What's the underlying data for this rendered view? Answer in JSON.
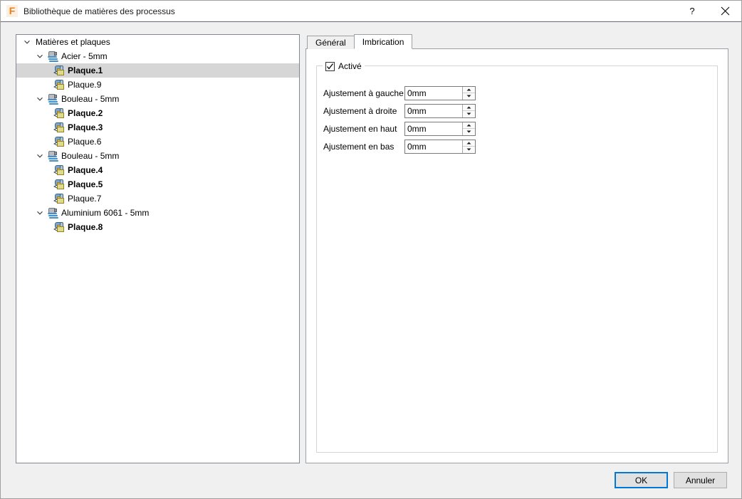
{
  "window": {
    "title": "Bibliothèque de matières des processus",
    "app_icon": "f-logo-icon",
    "help_label": "?",
    "close_label": "✕"
  },
  "tree": {
    "root": {
      "label": "Matières et plaques",
      "expanded": true
    },
    "groups": [
      {
        "label": "Acier - 5mm",
        "expanded": true,
        "icon": "material-stack-icon",
        "plates": [
          {
            "label": "Plaque.1",
            "bold": true,
            "selected": true,
            "icon": "plate-icon"
          },
          {
            "label": "Plaque.9",
            "bold": false,
            "selected": false,
            "icon": "plate-icon"
          }
        ]
      },
      {
        "label": "Bouleau - 5mm",
        "expanded": true,
        "icon": "material-stack-icon",
        "plates": [
          {
            "label": "Plaque.2",
            "bold": true,
            "selected": false,
            "icon": "plate-icon"
          },
          {
            "label": "Plaque.3",
            "bold": true,
            "selected": false,
            "icon": "plate-icon"
          },
          {
            "label": "Plaque.6",
            "bold": false,
            "selected": false,
            "icon": "plate-icon"
          }
        ]
      },
      {
        "label": "Bouleau - 5mm",
        "expanded": true,
        "icon": "material-stack-icon",
        "plates": [
          {
            "label": "Plaque.4",
            "bold": true,
            "selected": false,
            "icon": "plate-icon"
          },
          {
            "label": "Plaque.5",
            "bold": true,
            "selected": false,
            "icon": "plate-icon"
          },
          {
            "label": "Plaque.7",
            "bold": false,
            "selected": false,
            "icon": "plate-icon"
          }
        ]
      },
      {
        "label": "Aluminium 6061 - 5mm",
        "expanded": true,
        "icon": "material-stack-icon",
        "plates": [
          {
            "label": "Plaque.8",
            "bold": true,
            "selected": false,
            "icon": "plate-icon"
          }
        ]
      }
    ]
  },
  "tabs": [
    {
      "label": "Général",
      "active": false
    },
    {
      "label": "Imbrication",
      "active": true
    }
  ],
  "panel": {
    "groupbox": {
      "legend": "Activé",
      "checked": true
    },
    "fields": [
      {
        "label": "Ajustement à gauche",
        "value": "0mm"
      },
      {
        "label": "Ajustement à droite",
        "value": "0mm"
      },
      {
        "label": "Ajustement en haut",
        "value": "0mm"
      },
      {
        "label": "Ajustement en bas",
        "value": "0mm"
      }
    ]
  },
  "footer": {
    "ok_label": "OK",
    "cancel_label": "Annuler"
  },
  "colors": {
    "accent": "#0078d7",
    "selection": "#d6d6d6",
    "window_bg": "#f0f0f0",
    "panel_bg": "#ffffff",
    "border": "#828790"
  }
}
